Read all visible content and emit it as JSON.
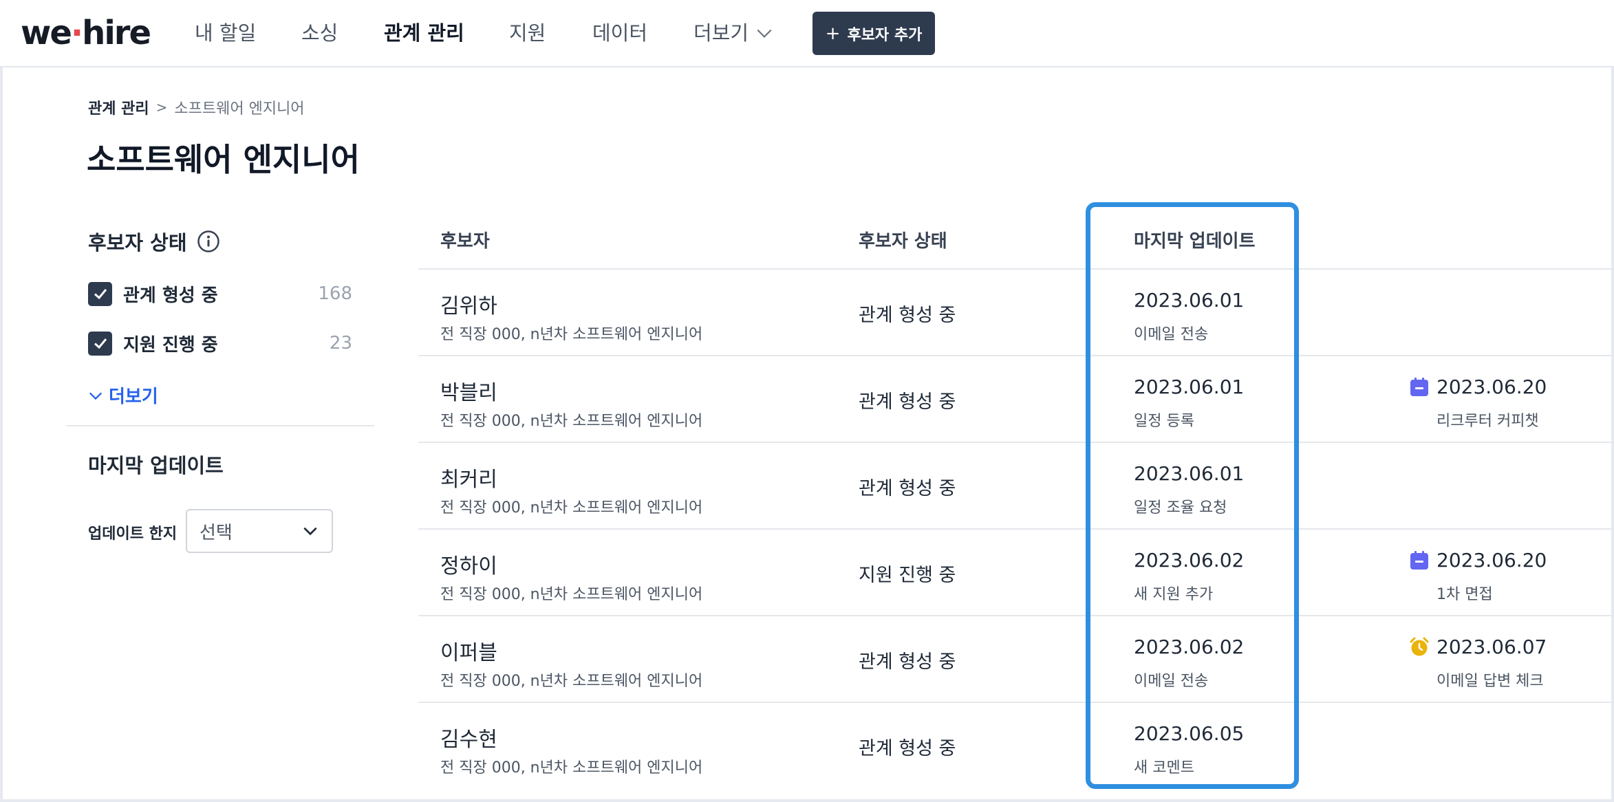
{
  "app": {
    "logo_left": "we",
    "logo_dot": "·",
    "logo_right": "hire"
  },
  "nav": {
    "items": [
      {
        "label": "내 할일"
      },
      {
        "label": "소싱"
      },
      {
        "label": "관계 관리",
        "active": true
      },
      {
        "label": "지원"
      },
      {
        "label": "데이터"
      },
      {
        "label": "더보기"
      }
    ],
    "add_button": {
      "icon": "+",
      "label": "후보자 추가"
    }
  },
  "breadcrumb": {
    "root": "관계 관리",
    "separator": ">",
    "current": "소프트웨어 엔지니어"
  },
  "page_title": "소프트웨어 엔지니어",
  "sidebar": {
    "status_heading": "후보자 상태",
    "filters": [
      {
        "label": "관계 형성 중",
        "count": "168",
        "checked": true
      },
      {
        "label": "지원 진행 중",
        "count": "23",
        "checked": true
      }
    ],
    "more_label": "더보기",
    "update_heading": "마지막 업데이트",
    "update_limit_label": "업데이트 한지",
    "select_value": "선택"
  },
  "table": {
    "headers": {
      "candidate": "후보자",
      "status": "후보자 상태",
      "last_update": "마지막 업데이트"
    },
    "rows": [
      {
        "name": "김위하",
        "sub": "전 직장 000, n년차 소프트웨어 엔지니어",
        "status": "관계 형성 중",
        "update_date": "2023.06.01",
        "update_desc": "이메일 전송"
      },
      {
        "name": "박블리",
        "sub": "전 직장 000, n년차 소프트웨어 엔지니어",
        "status": "관계 형성 중",
        "update_date": "2023.06.01",
        "update_desc": "일정 등록",
        "sched_icon": "calendar-icon",
        "sched_date": "2023.06.20",
        "sched_desc": "리크루터 커피챗"
      },
      {
        "name": "최커리",
        "sub": "전 직장 000, n년차 소프트웨어 엔지니어",
        "status": "관계 형성 중",
        "update_date": "2023.06.01",
        "update_desc": "일정 조율 요청"
      },
      {
        "name": "정하이",
        "sub": "전 직장 000, n년차 소프트웨어 엔지니어",
        "status": "지원 진행 중",
        "update_date": "2023.06.02",
        "update_desc": "새 지원 추가",
        "sched_icon": "calendar-icon",
        "sched_date": "2023.06.20",
        "sched_desc": "1차 면접"
      },
      {
        "name": "이퍼블",
        "sub": "전 직장 000, n년차 소프트웨어 엔지니어",
        "status": "관계 형성 중",
        "update_date": "2023.06.02",
        "update_desc": "이메일 전송",
        "sched_icon": "alarm-clock-icon",
        "sched_date": "2023.06.07",
        "sched_desc": "이메일 답변 체크"
      },
      {
        "name": "김수현",
        "sub": "전 직장 000, n년차 소프트웨어 엔지니어",
        "status": "관계 형성 중",
        "update_date": "2023.06.05",
        "update_desc": "새 코멘트"
      }
    ]
  },
  "colors": {
    "highlight": "#2f8fe0",
    "calendar": "#6366f1",
    "alarm": "#eab308",
    "primary_dark": "#2e3a4e",
    "link": "#2563eb"
  }
}
